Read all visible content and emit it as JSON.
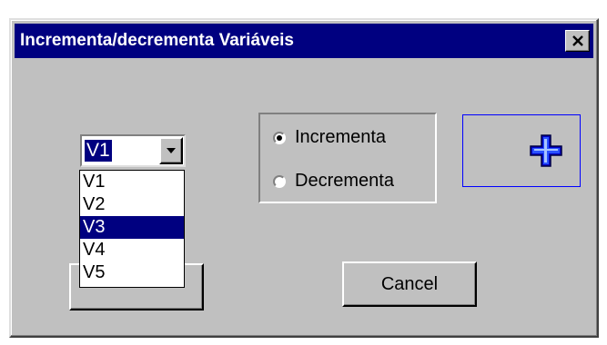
{
  "window": {
    "title": "Incrementa/decrementa Variáveis",
    "close_label": "✕"
  },
  "combo": {
    "selected": "V1",
    "options": [
      "V1",
      "V2",
      "V3",
      "V4",
      "V5"
    ],
    "highlighted": "V3"
  },
  "radio": {
    "options": [
      {
        "label": "Incrementa",
        "checked": true
      },
      {
        "label": "Decrementa",
        "checked": false
      }
    ]
  },
  "buttons": {
    "ok_label": "",
    "cancel_label": "Cancel"
  },
  "icons": {
    "preview": "plus-icon",
    "close": "close-icon",
    "dropdown": "chevron-down-icon"
  },
  "colors": {
    "titlebar": "#000080",
    "face": "#c0c0c0",
    "selection": "#000080",
    "preview_border": "#0000ff",
    "plus": "#0000ff"
  }
}
